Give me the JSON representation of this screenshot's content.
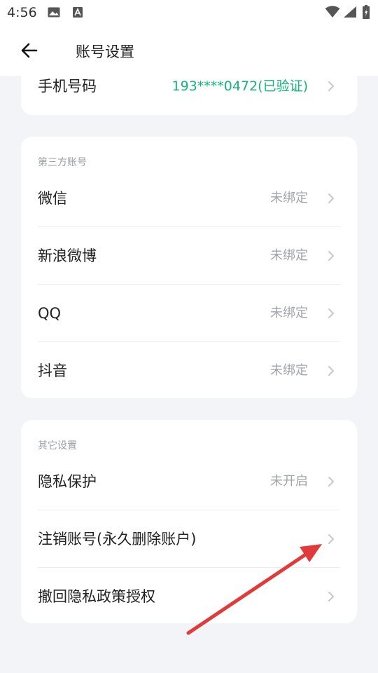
{
  "status_bar": {
    "time": "4:56",
    "icons": [
      "photo-icon",
      "a-notification-icon",
      "wifi-icon",
      "signal-icon",
      "battery-charging-icon"
    ]
  },
  "header": {
    "title": "账号设置",
    "back_icon": "back-arrow-icon"
  },
  "phone_card": {
    "label": "手机号码",
    "value": "193****0472(已验证)"
  },
  "third_party": {
    "section_title": "第三方账号",
    "items": [
      {
        "label": "微信",
        "value": "未绑定"
      },
      {
        "label": "新浪微博",
        "value": "未绑定"
      },
      {
        "label": "QQ",
        "value": "未绑定"
      },
      {
        "label": "抖音",
        "value": "未绑定"
      }
    ]
  },
  "other_settings": {
    "section_title": "其它设置",
    "items": [
      {
        "label": "隐私保护",
        "value": "未开启"
      },
      {
        "label": "注销账号(永久删除账户)",
        "value": ""
      },
      {
        "label": "撤回隐私政策授权",
        "value": ""
      }
    ]
  },
  "colors": {
    "accent_green": "#12b57a",
    "annotation_arrow": "#e03a3a",
    "background": "#f3f4f7"
  }
}
